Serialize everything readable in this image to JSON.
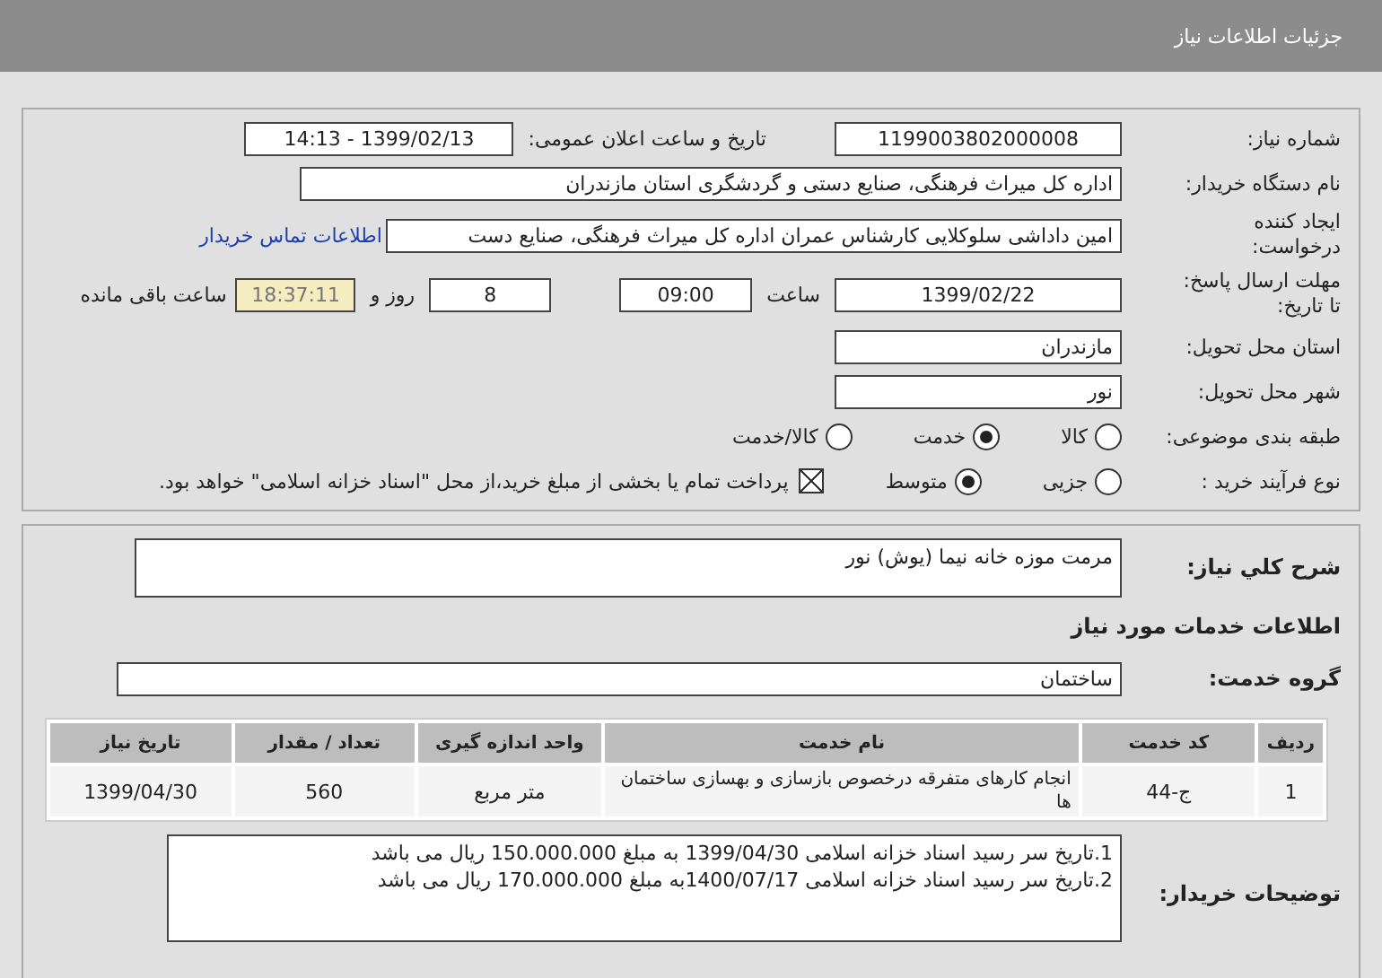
{
  "header": {
    "title": "جزئیات اطلاعات نیاز"
  },
  "need_number": {
    "label": "شماره نیاز:",
    "value": "1199003802000008"
  },
  "announce": {
    "label": "تاریخ و ساعت اعلان عمومی:",
    "value": "1399/02/13 - 14:13"
  },
  "buyer": {
    "label": "نام دستگاه خریدار:",
    "value": "اداره کل میراث فرهنگی، صنایع دستی و گردشگری استان مازندران"
  },
  "creator": {
    "label": "ایجاد کننده درخواست:",
    "value": "امین داداشی سلوکلایی کارشناس عمران اداره کل میراث فرهنگی، صنایع دست",
    "link": "اطلاعات تماس خریدار"
  },
  "deadline": {
    "label": "مهلت ارسال پاسخ: تا تاریخ:",
    "date": "1399/02/22",
    "time_label": "ساعت",
    "time": "09:00",
    "days": "8",
    "days_label": "روز و",
    "remaining": "18:37:11",
    "remaining_label": "ساعت باقی مانده"
  },
  "province": {
    "label": "استان محل تحویل:",
    "value": "مازندران"
  },
  "city": {
    "label": "شهر محل تحویل:",
    "value": "نور"
  },
  "category": {
    "label": "طبقه بندی موضوعی:",
    "options": [
      {
        "label": "کالا",
        "selected": false
      },
      {
        "label": "خدمت",
        "selected": true
      },
      {
        "label": "کالا/خدمت",
        "selected": false
      }
    ]
  },
  "process": {
    "label": "نوع فرآیند خرید :",
    "options": [
      {
        "label": "جزیی",
        "selected": false
      },
      {
        "label": "متوسط",
        "selected": true
      }
    ],
    "payment": {
      "checked": true,
      "text": "پرداخت تمام یا بخشی از مبلغ خرید،از محل \"اسناد خزانه اسلامی\" خواهد بود."
    }
  },
  "description": {
    "label": "شرح کلي نياز:",
    "value": "مرمت موزه خانه نیما (یوش) نور"
  },
  "services_heading": "اطلاعات خدمات مورد نیاز",
  "service_group": {
    "label": "گروه خدمت:",
    "value": "ساختمان"
  },
  "table": {
    "columns": [
      "ردیف",
      "کد خدمت",
      "نام خدمت",
      "واحد اندازه گیری",
      "تعداد / مقدار",
      "تاریخ نیاز"
    ],
    "rows": [
      [
        "1",
        "ج-44",
        "انجام کارهای متفرقه درخصوص بازسازی و بهسازی ساختمان ها",
        "متر مربع",
        "560",
        "1399/04/30"
      ]
    ]
  },
  "buyer_notes": {
    "label": "توضیحات خریدار:",
    "lines": [
      "1.تاریخ سر رسید اسناد خزانه اسلامی 1399/04/30 به مبلغ 150.000.000 ریال می باشد",
      "2.تاریخ سر رسید اسناد خزانه اسلامی 1400/07/17به مبلغ 170.000.000 ریال می باشد"
    ]
  }
}
